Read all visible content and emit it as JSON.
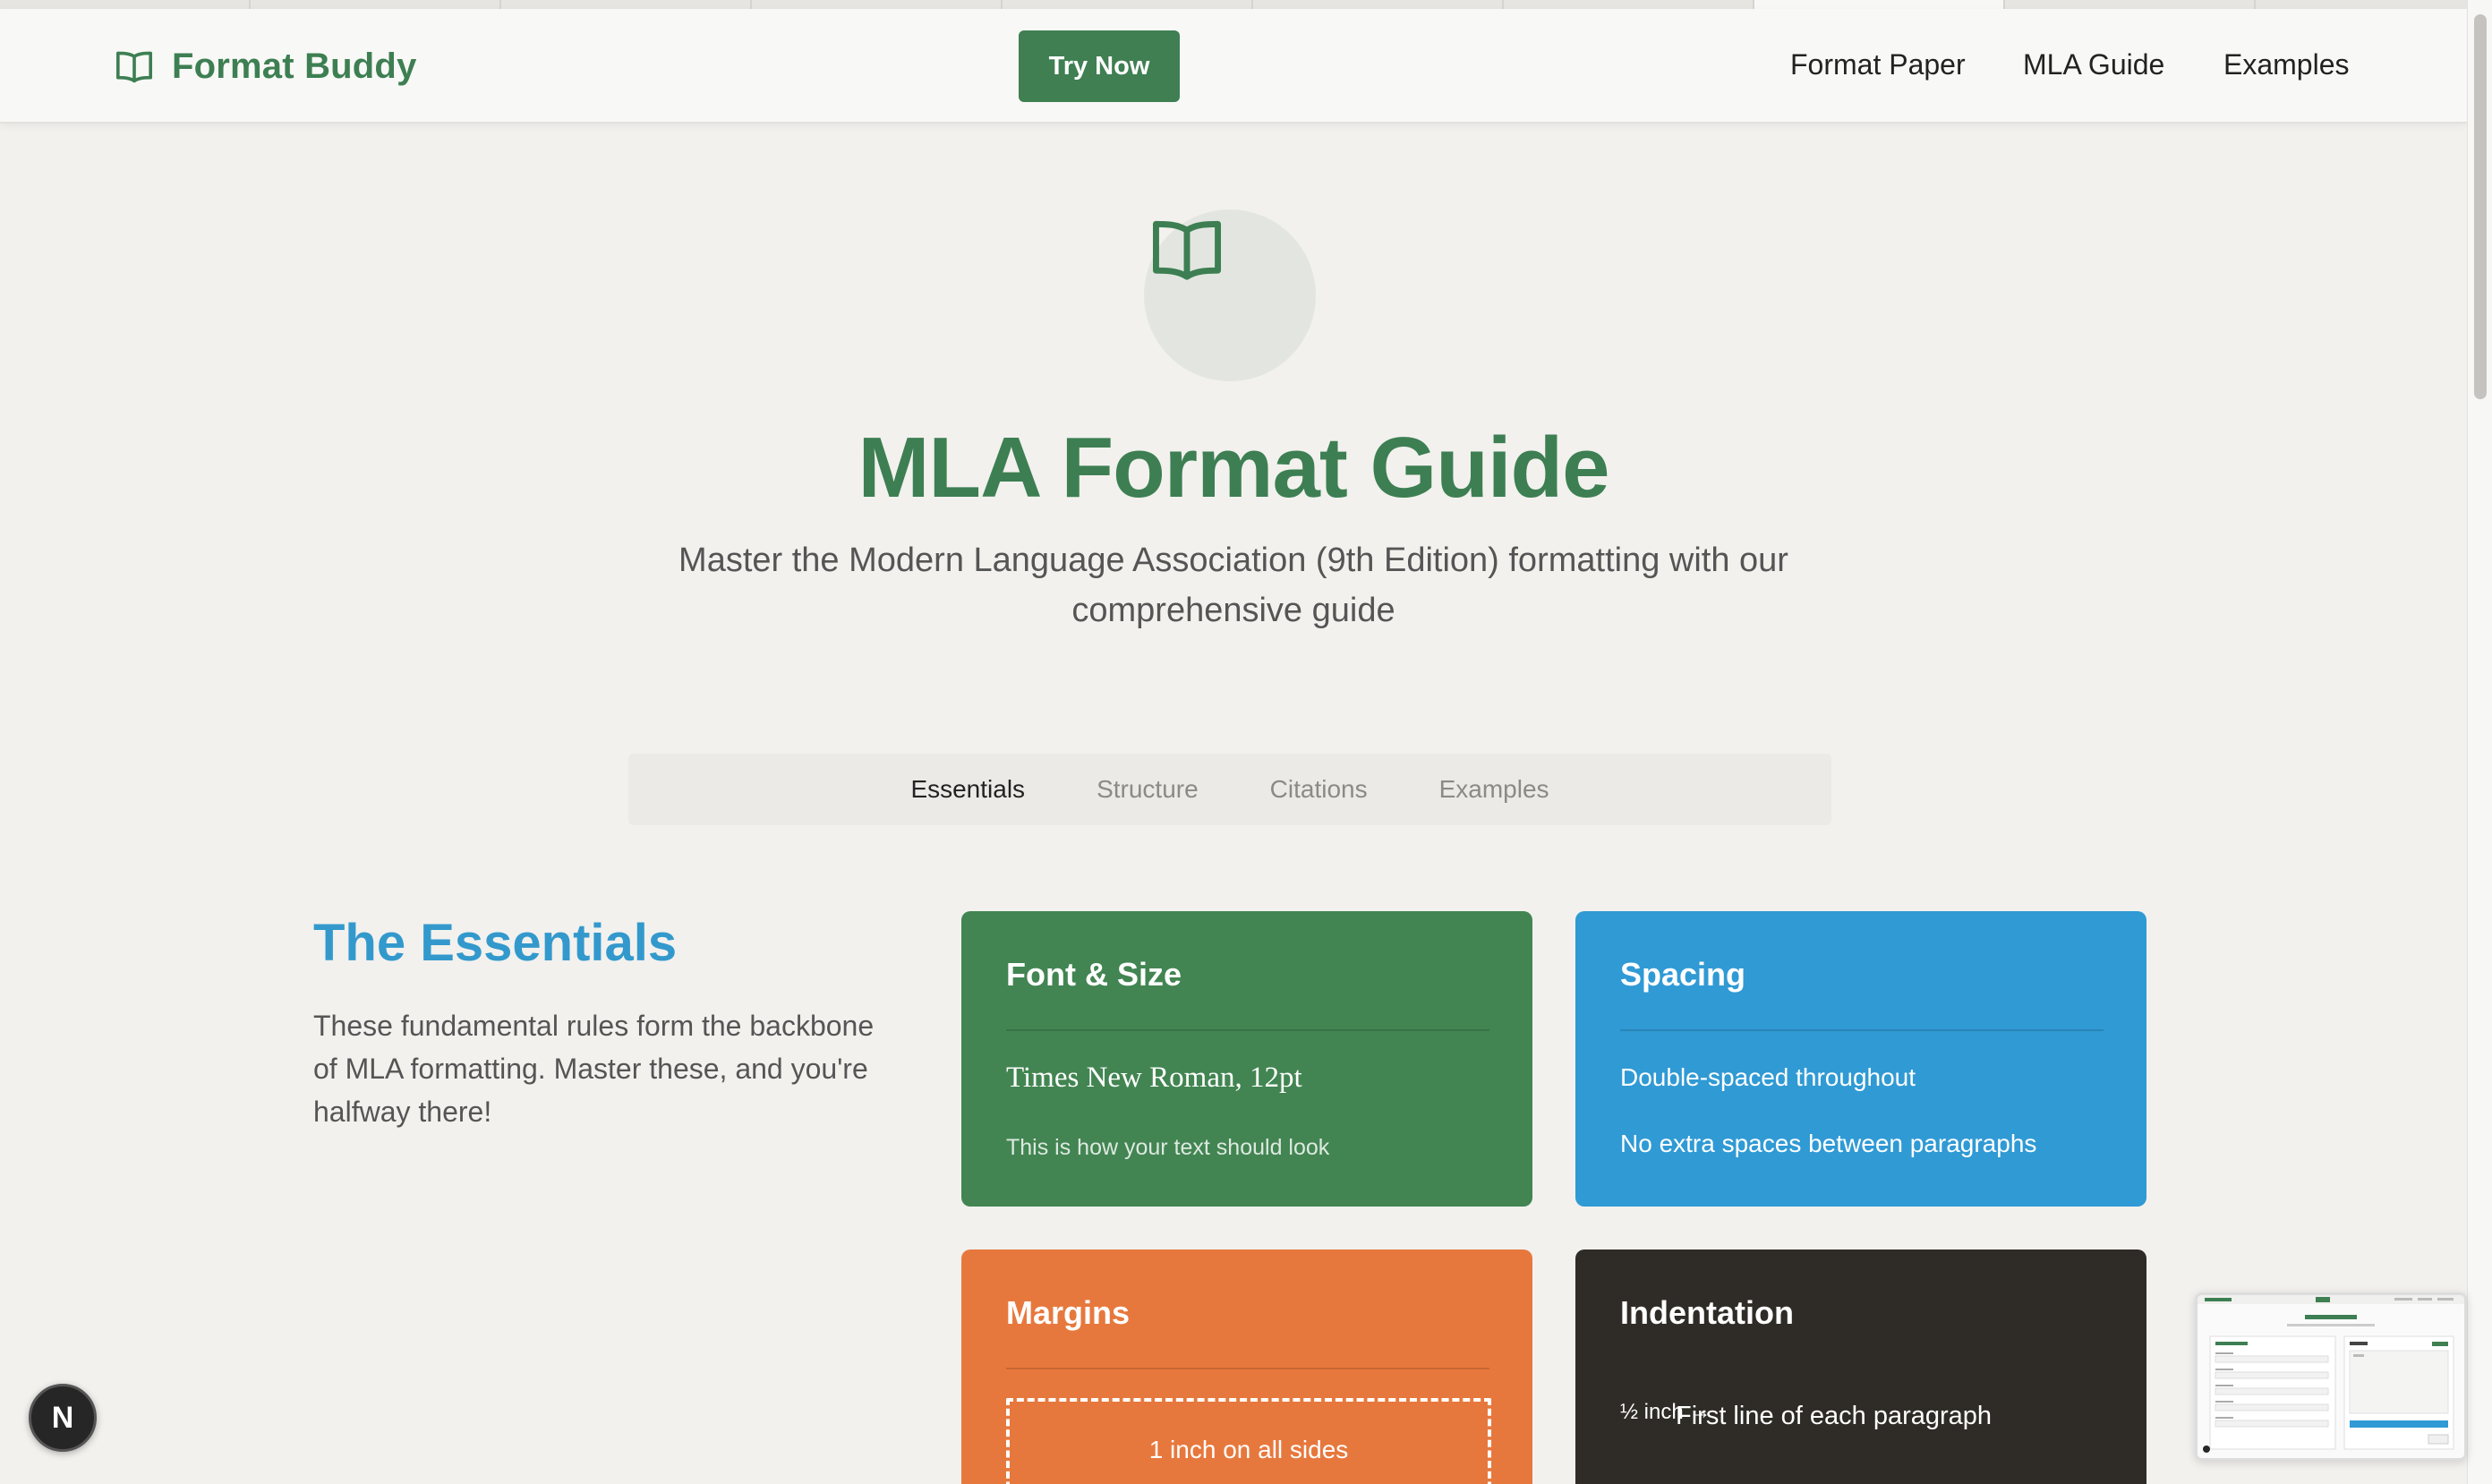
{
  "brand": {
    "name": "Format Buddy"
  },
  "header": {
    "cta_label": "Try Now",
    "nav": [
      "Format Paper",
      "MLA Guide",
      "Examples"
    ]
  },
  "hero": {
    "title": "MLA Format Guide",
    "subtitle": "Master the Modern Language Association (9th Edition) formatting with our comprehensive guide"
  },
  "tabs": [
    {
      "label": "Essentials",
      "active": true
    },
    {
      "label": "Structure",
      "active": false
    },
    {
      "label": "Citations",
      "active": false
    },
    {
      "label": "Examples",
      "active": false
    }
  ],
  "essentials": {
    "title": "The Essentials",
    "description": "These fundamental rules form the backbone of MLA formatting. Master these, and you're halfway there!"
  },
  "cards": {
    "font": {
      "title": "Font & Size",
      "sample": "Times New Roman, 12pt",
      "caption": "This is how your text should look",
      "color": "#428552"
    },
    "spacing": {
      "title": "Spacing",
      "line1": "Double-spaced throughout",
      "line2": "No extra spaces between paragraphs",
      "color": "#309ad4"
    },
    "margins": {
      "title": "Margins",
      "box_text": "1 inch on all sides",
      "color": "#e7783d"
    },
    "indentation": {
      "title": "Indentation",
      "marker": "½ inch →",
      "text": "First line of each paragraph",
      "color": "#2f2b26"
    }
  },
  "badge": {
    "letter": "N"
  },
  "colors": {
    "brand_green": "#3d7f52",
    "essentials_blue": "#3399cc",
    "background": "#f2f1ee"
  },
  "icons": {
    "logo": "open-book-icon",
    "hero": "open-book-icon"
  }
}
